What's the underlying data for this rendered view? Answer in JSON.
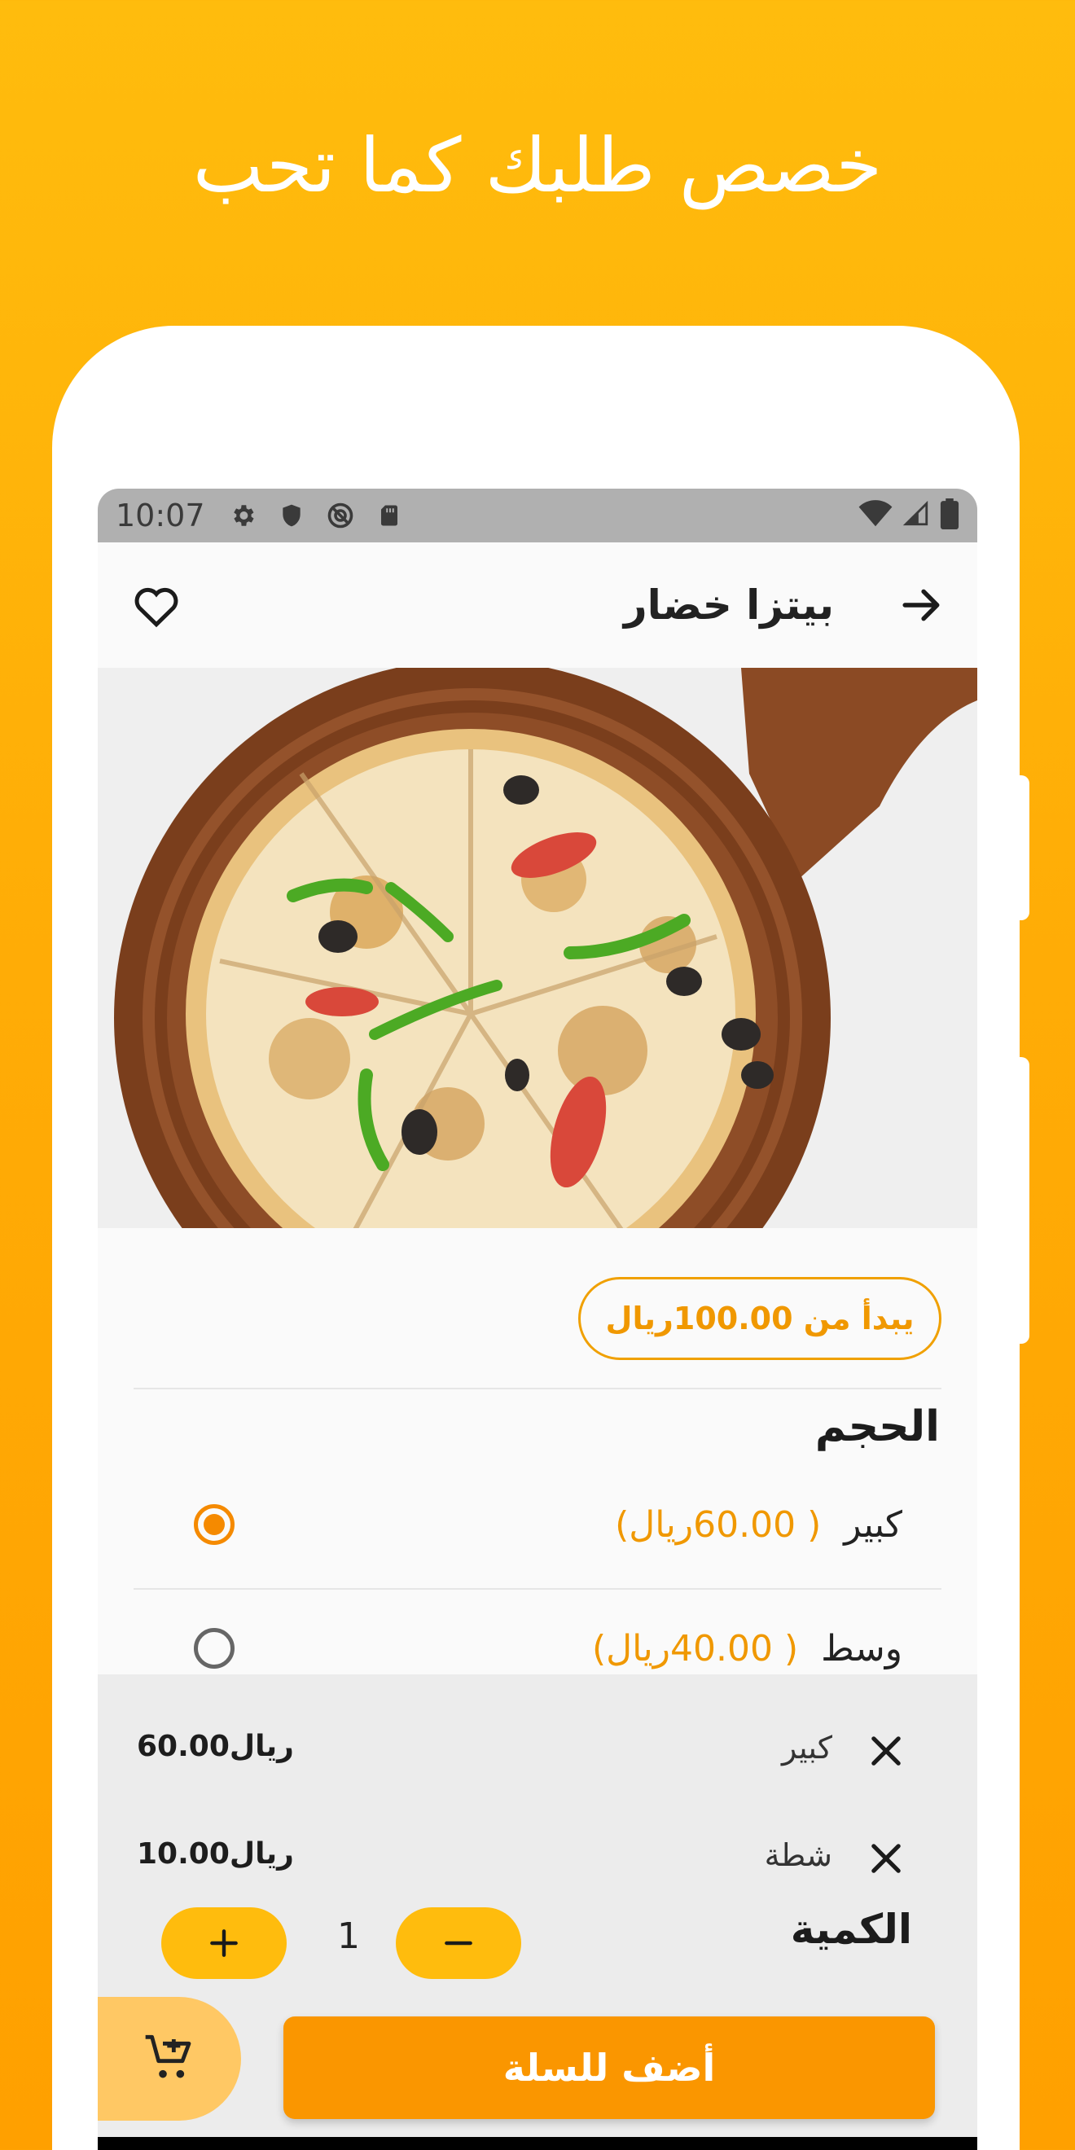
{
  "promo": {
    "headline": "خصص طلبك كما تحب"
  },
  "status_bar": {
    "time": "10:07"
  },
  "app_bar": {
    "title": "بيتزا خضار"
  },
  "product": {
    "price_from": "يبدأ من  100.00ريال"
  },
  "size_section": {
    "title": "الحجم",
    "options": [
      {
        "name": "كبير",
        "price": "( 60.00ريال)",
        "selected": true
      },
      {
        "name": "وسط",
        "price": "( 40.00ريال)",
        "selected": false
      }
    ]
  },
  "selections": [
    {
      "name": "كبير",
      "amount": "60.00ريال"
    },
    {
      "name": "شطة",
      "amount": "10.00ريال"
    }
  ],
  "quantity": {
    "label": "الكمية",
    "value": "1"
  },
  "cart": {
    "add_label": "أضف للسلة"
  },
  "colors": {
    "accent": "#FA9600",
    "accent_light": "#FFBC0D",
    "price_text": "#F09800"
  }
}
